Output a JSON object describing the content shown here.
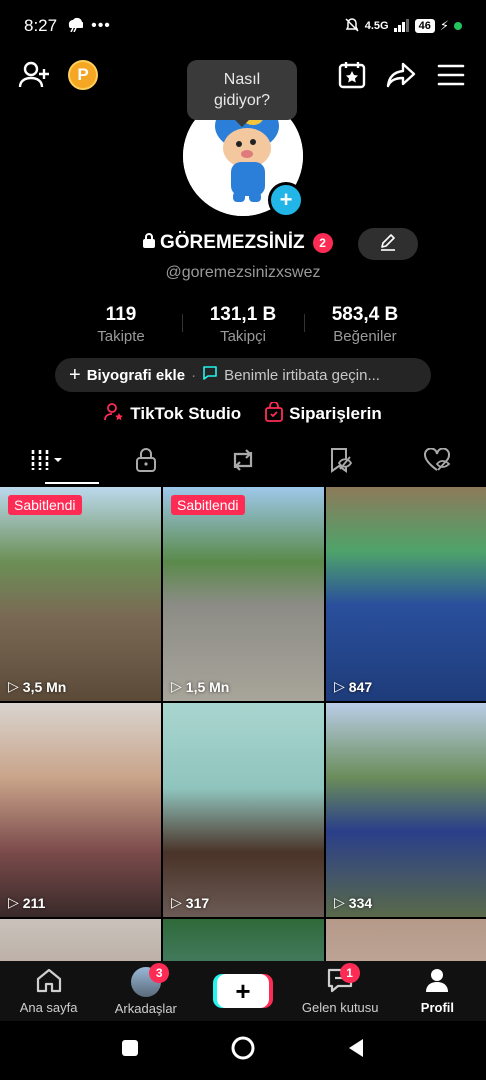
{
  "status": {
    "time": "8:27",
    "network": "4.5G",
    "battery": "46"
  },
  "tooltip": {
    "text_line1": "Nasıl",
    "text_line2": "gidiyor?"
  },
  "profile": {
    "display_name": "GÖREMEZSİNİZ",
    "notification_count": "2",
    "username": "@goremezsinizxswez"
  },
  "stats": [
    {
      "value": "119",
      "label": "Takipte"
    },
    {
      "value": "131,1 B",
      "label": "Takipçi"
    },
    {
      "value": "583,4 B",
      "label": "Beğeniler"
    }
  ],
  "bio": {
    "add_label": "Biyografi ekle",
    "separator": "·",
    "contact_label": "Benimle irtibata geçin..."
  },
  "links": {
    "studio": "TikTok Studio",
    "orders": "Siparişlerin"
  },
  "videos": [
    {
      "pinned": "Sabitlendi",
      "views": "3,5 Mn"
    },
    {
      "pinned": "Sabitlendi",
      "views": "1,5 Mn"
    },
    {
      "pinned": "",
      "views": "847"
    },
    {
      "pinned": "",
      "views": "211"
    },
    {
      "pinned": "",
      "views": "317"
    },
    {
      "pinned": "",
      "views": "334"
    }
  ],
  "nav": {
    "home": "Ana sayfa",
    "friends": "Arkadaşlar",
    "friends_badge": "3",
    "inbox": "Gelen kutusu",
    "inbox_badge": "1",
    "profile": "Profil"
  },
  "colors": {
    "accent": "#fe2c55",
    "cyan": "#25f4ee",
    "avatar_add": "#22b5e8",
    "coin": "#f5a623"
  }
}
